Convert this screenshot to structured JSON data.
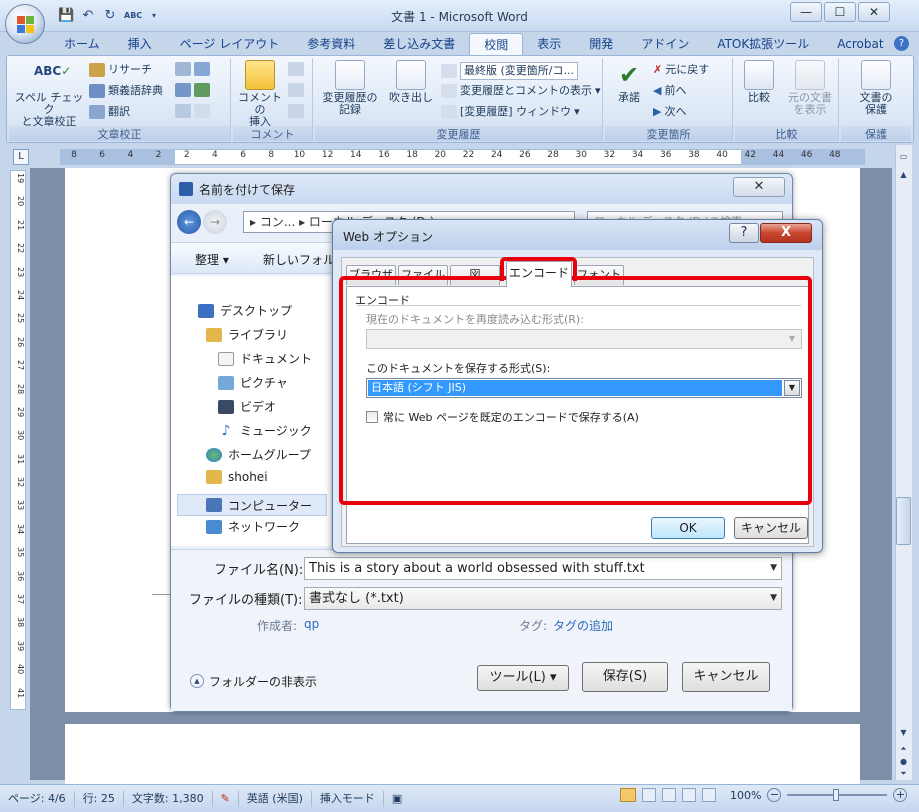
{
  "window": {
    "title": "文書 1 - Microsoft Word"
  },
  "ribbon": {
    "tabs": [
      "ホーム",
      "挿入",
      "ページ レイアウト",
      "参考資料",
      "差し込み文書",
      "校閲",
      "表示",
      "開発",
      "アドイン",
      "ATOK拡張ツール",
      "Acrobat"
    ],
    "active_tab": "校閲",
    "groups": {
      "proofing": {
        "label": "文章校正",
        "spell_line1": "スペル チェック",
        "spell_line2": "と文章校正",
        "research": "リサーチ",
        "thesaurus": "類義語辞典",
        "translate": "翻訳"
      },
      "comments": {
        "label": "コメント",
        "insert_line1": "コメントの",
        "insert_line2": "挿入"
      },
      "tracking": {
        "label": "変更履歴",
        "track_line1": "変更履歴の",
        "track_line2": "記録",
        "balloons": "吹き出し",
        "final_mode": "最終版 (変更箇所/コ...",
        "show_markup": "変更履歴とコメントの表示",
        "review_pane": "[変更履歴] ウィンドウ"
      },
      "changes": {
        "label": "変更箇所",
        "accept": "承諾",
        "reject": "元に戻す",
        "previous": "前へ",
        "next": "次へ"
      },
      "compare": {
        "label": "比較",
        "compare_btn": "比較",
        "show_source_line1": "元の文書",
        "show_source_line2": "を表示"
      },
      "protect": {
        "label": "保護",
        "protect_line1": "文書の",
        "protect_line2": "保護"
      }
    }
  },
  "ruler": {
    "h_ticks": [
      "8",
      "6",
      "4",
      "2",
      "2",
      "4",
      "6",
      "8",
      "10",
      "12",
      "14",
      "16",
      "18",
      "20",
      "22",
      "24",
      "26",
      "28",
      "30",
      "32",
      "34",
      "36",
      "38",
      "40",
      "42",
      "44",
      "46",
      "48"
    ],
    "v_ticks": [
      "19",
      "20",
      "21",
      "22",
      "23",
      "24",
      "25",
      "26",
      "27",
      "28",
      "29",
      "30",
      "31",
      "32",
      "33",
      "34",
      "35",
      "36",
      "37",
      "38",
      "39",
      "40",
      "41"
    ],
    "corner": "L"
  },
  "save_dialog": {
    "title": "名前を付けて保存",
    "address": "▸ コン... ▸ ローカル ディスク (D:) ▸",
    "search_placeholder": "ローカル ディスク (D:)の検索",
    "organize": "整理 ▾",
    "new_folder": "新しいフォルダー",
    "nav_items": [
      "デスクトップ",
      "ライブラリ",
      "ドキュメント",
      "ピクチャ",
      "ビデオ",
      "ミュージック",
      "ホームグループ",
      "shohei",
      "コンピューター",
      "ネットワーク"
    ],
    "filename_label": "ファイル名(N):",
    "filename_value": "This is a story about a world obsessed with stuff.txt",
    "filetype_label": "ファイルの種類(T):",
    "filetype_value": "書式なし (*.txt)",
    "author_label": "作成者:",
    "author_value": "qp",
    "tags_label": "タグ:",
    "tags_value": "タグの追加",
    "hide_folders": "フォルダーの非表示",
    "tools": "ツール(L)",
    "save": "保存(S)",
    "cancel": "キャンセル"
  },
  "web_options": {
    "title": "Web オプション",
    "help": "?",
    "close": "X",
    "tabs": [
      "ブラウザ",
      "ファイル",
      "図",
      "エンコード",
      "フォント"
    ],
    "active_tab": "エンコード",
    "section_title": "エンコード",
    "reload_label": "現在のドキュメントを再度読み込む形式(R):",
    "reload_value": "",
    "save_as_label": "このドキュメントを保存する形式(S):",
    "save_as_value": "日本語 (シフト JIS)",
    "checkbox_label": "常に Web ページを既定のエンコードで保存する(A)",
    "checkbox_checked": false,
    "ok": "OK",
    "cancel": "キャンセル"
  },
  "status_bar": {
    "page": "ページ: 4/6",
    "line": "行: 25",
    "words": "文字数: 1,380",
    "language": "英語 (米国)",
    "insert_mode": "挿入モード",
    "zoom": "100%"
  },
  "colors": {
    "highlight": "#e8000d",
    "selection": "#3399ff",
    "ribbon_bg": "#dce7f6"
  }
}
